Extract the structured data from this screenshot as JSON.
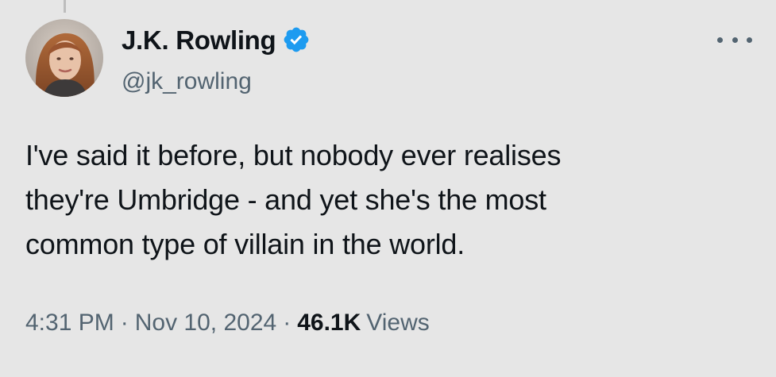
{
  "author": {
    "display_name": "J.K. Rowling",
    "handle": "@jk_rowling",
    "verified": true,
    "verified_color": "#1d9bf0"
  },
  "tweet": {
    "text": "I've said it before, but nobody ever realises\nthey're Umbridge - and yet she's the most\ncommon type of villain in the world."
  },
  "meta": {
    "time": "4:31 PM",
    "separator": "·",
    "date": "Nov 10, 2024",
    "views_count": "46.1K",
    "views_label": "Views"
  },
  "icons": {
    "verified": "verified-badge-icon",
    "more": "more-options-icon"
  },
  "colors": {
    "background": "#e6e6e6",
    "primary_text": "#0f1419",
    "secondary_text": "#536471",
    "accent": "#1d9bf0"
  }
}
